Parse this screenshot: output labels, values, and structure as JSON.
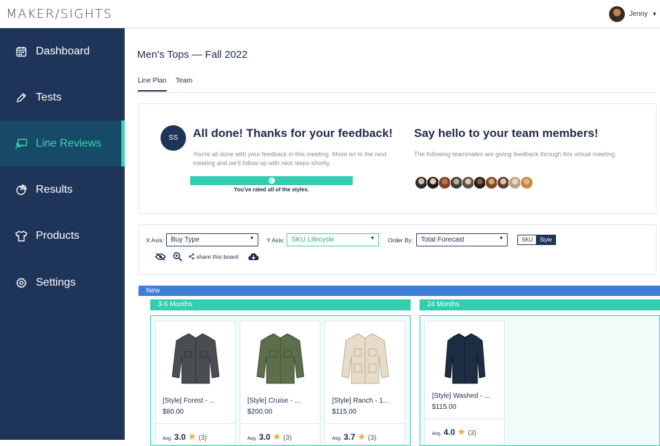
{
  "app": {
    "logo": "MAKER/SIGHTS"
  },
  "user": {
    "name": "Jenny"
  },
  "sidebar": {
    "items": [
      {
        "label": "Dashboard",
        "icon": "calendar-icon"
      },
      {
        "label": "Tests",
        "icon": "pencil-icon"
      },
      {
        "label": "Line Reviews",
        "icon": "presentation-icon",
        "active": true
      },
      {
        "label": "Results",
        "icon": "pie-chart-icon"
      },
      {
        "label": "Products",
        "icon": "tshirt-icon"
      },
      {
        "label": "Settings",
        "icon": "gear-icon"
      }
    ]
  },
  "page": {
    "title": "Men’s Tops — Fall 2022"
  },
  "tabs": [
    {
      "label": "Line Plan",
      "active": true
    },
    {
      "label": "Team"
    }
  ],
  "feedback": {
    "initials": "SS",
    "title": "All done! Thanks for your feedback!",
    "body": "You're all done with your feedback in this meeting. Move on to the next meeting and we'll follow up with next steps shortly.",
    "progress_label": "You've rated all of the styles.",
    "progress": 1.0,
    "team_title": "Say hello to your team members!",
    "team_body": "The following teammates are giving feedback through this virtual meeting.",
    "team_count": 10
  },
  "filters": {
    "x_axis_label": "X Axis:",
    "x_axis_value": "Buy Type",
    "y_axis_label": "Y Axis:",
    "y_axis_value": "SKU Lifecycle",
    "order_label": "Order By:",
    "order_value": "Total Forecast",
    "toggle_sku": "SKU",
    "toggle_style": "Style",
    "share_label": "share this board"
  },
  "board": {
    "lane": "New",
    "groups": [
      {
        "label": "3-6 Months",
        "products": [
          {
            "name": "[Style] Forest - ...",
            "price": "$80.00",
            "avg_label": "Avg.",
            "avg": "3.0",
            "count": "(3)",
            "color": "#4a4d51"
          },
          {
            "name": "[Style] Cruise - ...",
            "price": "$200.00",
            "avg_label": "Avg.",
            "avg": "3.0",
            "count": "(3)",
            "color": "#5c6e4a"
          },
          {
            "name": "[Style] Ranch - 1...",
            "price": "$115.00",
            "avg_label": "Avg.",
            "avg": "3.7",
            "count": "(3)",
            "color": "#e6dcc8"
          }
        ]
      },
      {
        "label": "24 Months",
        "products": [
          {
            "name": "[Style] Washed - ...",
            "price": "$115.00",
            "avg_label": "Avg.",
            "avg": "4.0",
            "count": "(3)",
            "color": "#1d2d42"
          }
        ]
      }
    ]
  }
}
